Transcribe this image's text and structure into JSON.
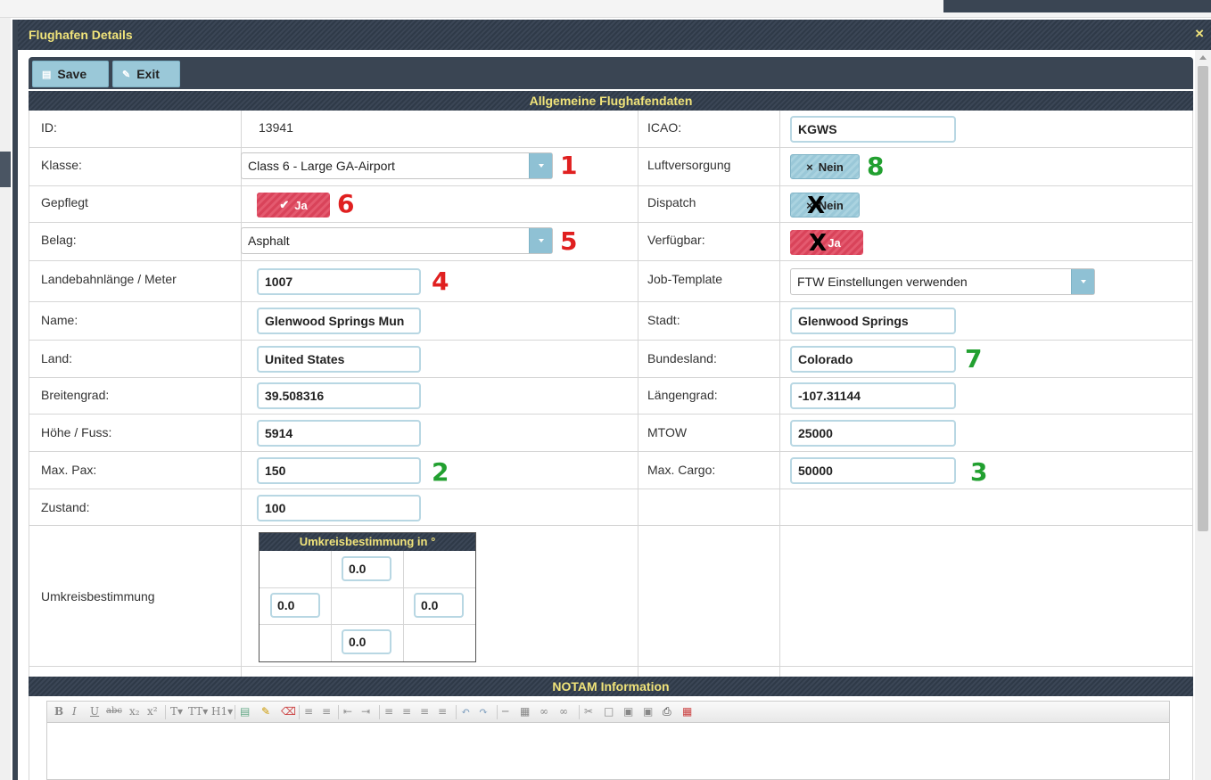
{
  "dialog": {
    "title": "Flughafen Details",
    "close_label": "×"
  },
  "toolbar": {
    "save_label": "Save",
    "exit_label": "Exit"
  },
  "sections": {
    "general": "Allgemeine Flughafendaten",
    "notam": "NOTAM Information",
    "umkreis_header": "Umkreisbestimmung in °"
  },
  "fields": {
    "id": {
      "label": "ID:",
      "value": "13941"
    },
    "klasse": {
      "label": "Klasse:",
      "value": "Class 6 - Large GA-Airport"
    },
    "gepflegt": {
      "label": "Gepflegt",
      "value": "Ja"
    },
    "belag": {
      "label": "Belag:",
      "value": "Asphalt"
    },
    "landebahn": {
      "label": "Landebahnlänge / Meter",
      "value": "1007"
    },
    "name": {
      "label": "Name:",
      "value": "Glenwood Springs Mun"
    },
    "land": {
      "label": "Land:",
      "value": "United States"
    },
    "breitengrad": {
      "label": "Breitengrad:",
      "value": "39.508316"
    },
    "hoehe": {
      "label": "Höhe / Fuss:",
      "value": "5914"
    },
    "maxpax": {
      "label": "Max. Pax:",
      "value": "150"
    },
    "zustand": {
      "label": "Zustand:",
      "value": "100"
    },
    "umkreis": {
      "label": "Umkreisbestimmung",
      "north": "0.0",
      "west": "0.0",
      "east": "0.0",
      "south": "0.0"
    },
    "icao": {
      "label": "ICAO:",
      "value": "KGWS"
    },
    "luftversorgung": {
      "label": "Luftversorgung",
      "value": "Nein"
    },
    "dispatch": {
      "label": "Dispatch",
      "value": "Nein"
    },
    "verfuegbar": {
      "label": "Verfügbar:",
      "value": "Ja"
    },
    "jobtemplate": {
      "label": "Job-Template",
      "value": "FTW Einstellungen verwenden"
    },
    "stadt": {
      "label": "Stadt:",
      "value": "Glenwood Springs"
    },
    "bundesland": {
      "label": "Bundesland:",
      "value": "Colorado"
    },
    "laengengrad": {
      "label": "Längengrad:",
      "value": "-107.31144"
    },
    "mtow": {
      "label": "MTOW",
      "value": "25000"
    },
    "maxcargo": {
      "label": "Max. Cargo:",
      "value": "50000"
    }
  },
  "annotations": [
    "1",
    "2",
    "3",
    "4",
    "5",
    "6",
    "7",
    "8"
  ],
  "strike_marks": [
    "X",
    "X"
  ],
  "editor_toolbar": [
    "B",
    "I",
    "U",
    "abc",
    "x₂",
    "x²",
    "T▾",
    "TT▾",
    "H1▾"
  ]
}
